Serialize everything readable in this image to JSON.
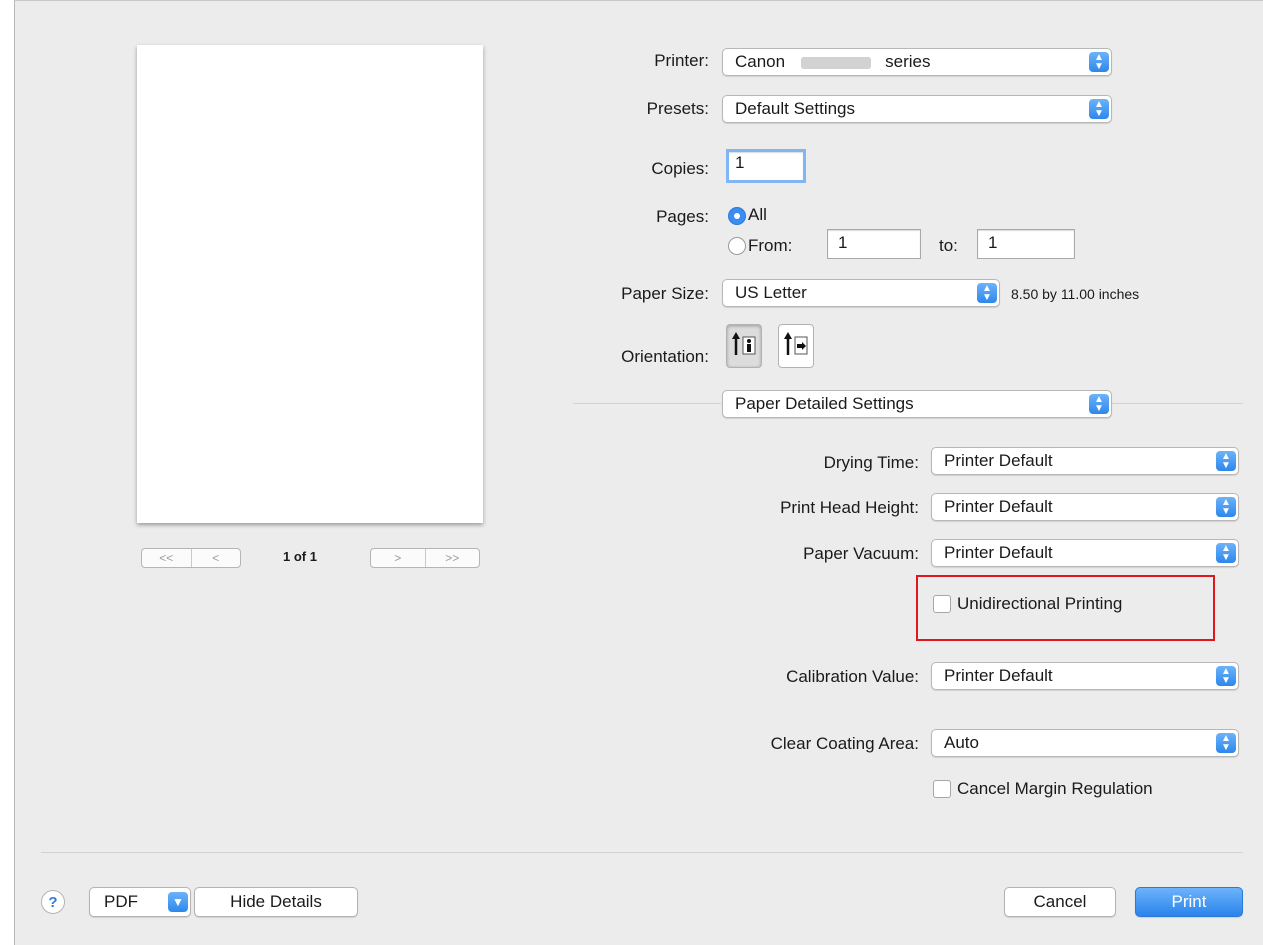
{
  "preview": {
    "page_indicator": "1 of 1",
    "first_label": "<<",
    "prev_label": "<",
    "next_label": ">",
    "last_label": ">>"
  },
  "printer": {
    "label": "Printer:",
    "value_prefix": "Canon",
    "value_suffix": "series"
  },
  "presets": {
    "label": "Presets:",
    "value": "Default Settings"
  },
  "copies": {
    "label": "Copies:",
    "value": "1"
  },
  "pages": {
    "label": "Pages:",
    "all_label": "All",
    "from_label": "From:",
    "from_value": "1",
    "to_label": "to:",
    "to_value": "1",
    "selected": "All"
  },
  "paper_size": {
    "label": "Paper Size:",
    "value": "US Letter",
    "dimensions": "8.50 by 11.00 inches"
  },
  "orientation": {
    "label": "Orientation:",
    "selected": "portrait"
  },
  "panel": {
    "value": "Paper Detailed Settings"
  },
  "drying_time": {
    "label": "Drying Time:",
    "value": "Printer Default"
  },
  "print_head_height": {
    "label": "Print Head Height:",
    "value": "Printer Default"
  },
  "paper_vacuum": {
    "label": "Paper Vacuum:",
    "value": "Printer Default"
  },
  "unidirectional": {
    "label": "Unidirectional Printing",
    "checked": false
  },
  "calibration_value": {
    "label": "Calibration Value:",
    "value": "Printer Default"
  },
  "clear_coating_area": {
    "label": "Clear Coating Area:",
    "value": "Auto"
  },
  "cancel_margin": {
    "label": "Cancel Margin Regulation",
    "checked": false
  },
  "footer": {
    "help_label": "?",
    "pdf_label": "PDF",
    "hide_details_label": "Hide Details",
    "cancel_label": "Cancel",
    "print_label": "Print"
  },
  "colors": {
    "accent": "#3a8ef2",
    "highlight_box": "#e2171e",
    "dialog_bg": "#ececec"
  },
  "icons": {
    "popup": "chevron-updown-icon",
    "help": "help-icon",
    "pdf_menu": "chevron-down-icon"
  }
}
